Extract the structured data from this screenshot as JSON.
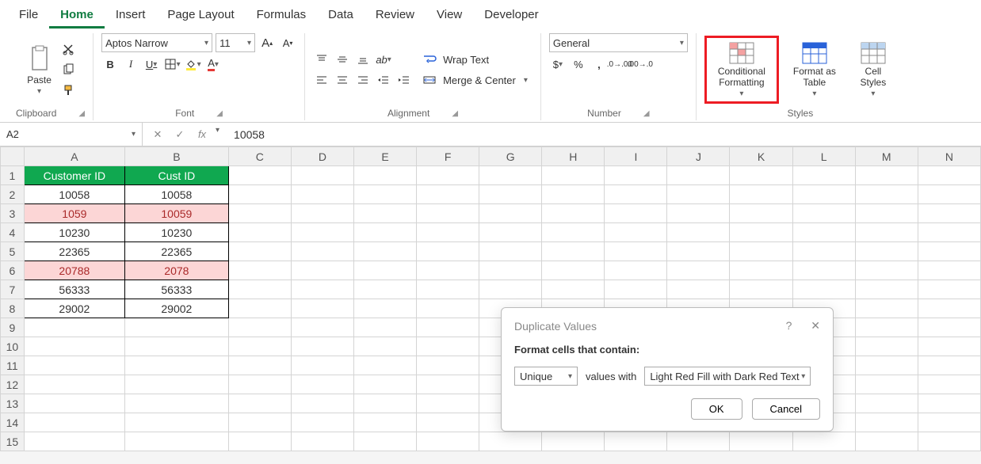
{
  "menu": {
    "tabs": [
      "File",
      "Home",
      "Insert",
      "Page Layout",
      "Formulas",
      "Data",
      "Review",
      "View",
      "Developer"
    ],
    "active": "Home"
  },
  "ribbon": {
    "clipboard": {
      "label": "Clipboard",
      "paste": "Paste"
    },
    "font": {
      "label": "Font",
      "family": "Aptos Narrow",
      "size": "11",
      "bold": "B",
      "italic": "I",
      "underline": "U"
    },
    "alignment": {
      "label": "Alignment",
      "wrap": "Wrap Text",
      "merge": "Merge & Center"
    },
    "number": {
      "label": "Number",
      "format": "General",
      "currency": "$",
      "percent": "%",
      "comma": ","
    },
    "styles": {
      "label": "Styles",
      "cond": "Conditional Formatting",
      "table": "Format as Table",
      "cell": "Cell Styles"
    }
  },
  "formula": {
    "namebox": "A2",
    "fx": "fx",
    "value": "10058"
  },
  "grid": {
    "cols": [
      "A",
      "B",
      "C",
      "D",
      "E",
      "F",
      "G",
      "H",
      "I",
      "J",
      "K",
      "L",
      "M",
      "N"
    ],
    "rows": [
      "1",
      "2",
      "3",
      "4",
      "5",
      "6",
      "7",
      "8",
      "9",
      "10",
      "11",
      "12",
      "13",
      "14",
      "15"
    ],
    "headers": {
      "A": "Customer ID",
      "B": "Cust ID"
    },
    "data": [
      {
        "A": "10058",
        "B": "10058",
        "hl": false
      },
      {
        "A": "1059",
        "B": "10059",
        "hl": true
      },
      {
        "A": "10230",
        "B": "10230",
        "hl": false
      },
      {
        "A": "22365",
        "B": "22365",
        "hl": false
      },
      {
        "A": "20788",
        "B": "2078",
        "hl": true
      },
      {
        "A": "56333",
        "B": "56333",
        "hl": false
      },
      {
        "A": "29002",
        "B": "29002",
        "hl": false
      }
    ]
  },
  "dialog": {
    "title": "Duplicate Values",
    "subtitle": "Format cells that contain:",
    "type": "Unique",
    "mid": "values with",
    "format": "Light Red Fill with Dark Red Text",
    "ok": "OK",
    "cancel": "Cancel",
    "help": "?",
    "close": "✕"
  }
}
